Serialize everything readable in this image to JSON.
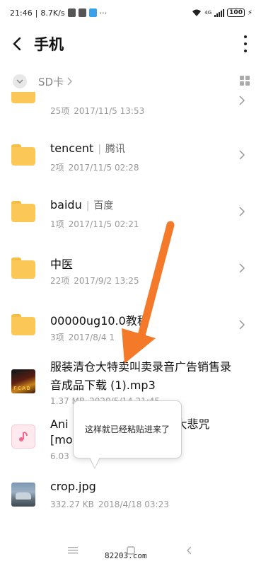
{
  "status_bar": {
    "time": "21:46",
    "speed": "8.7K/s",
    "network": "4G",
    "battery": "100"
  },
  "header": {
    "title": "手机"
  },
  "breadcrumb": {
    "path": "SD卡"
  },
  "files": [
    {
      "type": "folder",
      "name": "",
      "meta_count": "25项",
      "meta_date": "2017/11/5 13:53"
    },
    {
      "type": "folder",
      "name": "tencent",
      "alias": "腾讯",
      "meta_count": "2项",
      "meta_date": "2017/11/5 02:28"
    },
    {
      "type": "folder",
      "name": "baidu",
      "alias": "百度",
      "meta_count": "1项",
      "meta_date": "2017/11/5 02:21"
    },
    {
      "type": "folder",
      "name": "中医",
      "meta_count": "22项",
      "meta_date": "2017/9/2 13:25"
    },
    {
      "type": "folder",
      "name": "00000ug10.0教程",
      "meta_count": "3项",
      "meta_date": "2017/8/4 1"
    },
    {
      "type": "audio",
      "name": "服装清仓大特卖叫卖录音广告销售录音成品下载 (1).mp3",
      "meta_size": "1.37 MB",
      "meta_date": "2020/5/14 21:45"
    },
    {
      "type": "doc",
      "name": "Ani",
      "name_suffix": "大悲咒",
      "name_line2": "[mo",
      "meta_size": "6.03"
    },
    {
      "type": "image",
      "name": "crop.jpg",
      "meta_size": "332.27 KB",
      "meta_date": "2018/4/18 03:23"
    }
  ],
  "toast": {
    "text": "这样就已经粘贴进来了"
  },
  "overlay": {
    "arrow_color": "#f47a2a"
  },
  "watermark": "82203.com",
  "colors": {
    "folder": "#fbc756",
    "meta": "#999999",
    "arrow": "#f47a2a"
  }
}
